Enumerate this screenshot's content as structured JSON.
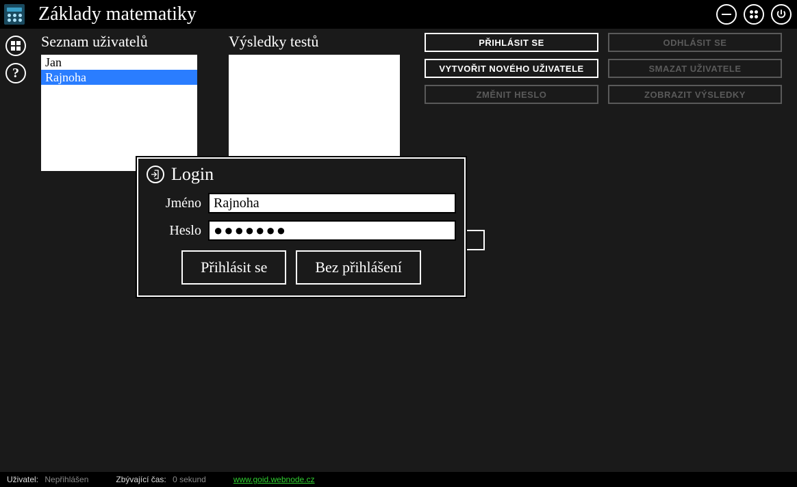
{
  "header": {
    "title": "Základy matematiky"
  },
  "columns": {
    "users_title": "Seznam uživatelů",
    "tests_title": "Výsledky testů",
    "users": [
      "Jan",
      "Rajnoha"
    ],
    "selected_user_index": 1
  },
  "actions": {
    "login": "PŘIHLÁSIT SE",
    "logout": "ODHLÁSIT SE",
    "create_user": "VYTVOŘIT NOVÉHO UŽIVATELE",
    "delete_user": "SMAZAT UŽIVATELE",
    "change_pw": "ZMĚNIT HESLO",
    "show_results": "ZOBRAZIT VÝSLEDKY"
  },
  "modal": {
    "title": "Login",
    "name_label": "Jméno",
    "pw_label": "Heslo",
    "name_value": "Rajnoha",
    "pw_mask": "●●●●●●●",
    "login_btn": "Přihlásit se",
    "skip_btn": "Bez přihlášení"
  },
  "status": {
    "user_label": "Uživatel:",
    "user_value": "Nepřihlášen",
    "time_label": "Zbývající čas:",
    "time_value": "0 sekund",
    "link_text": "www.goid.webnode.cz"
  }
}
